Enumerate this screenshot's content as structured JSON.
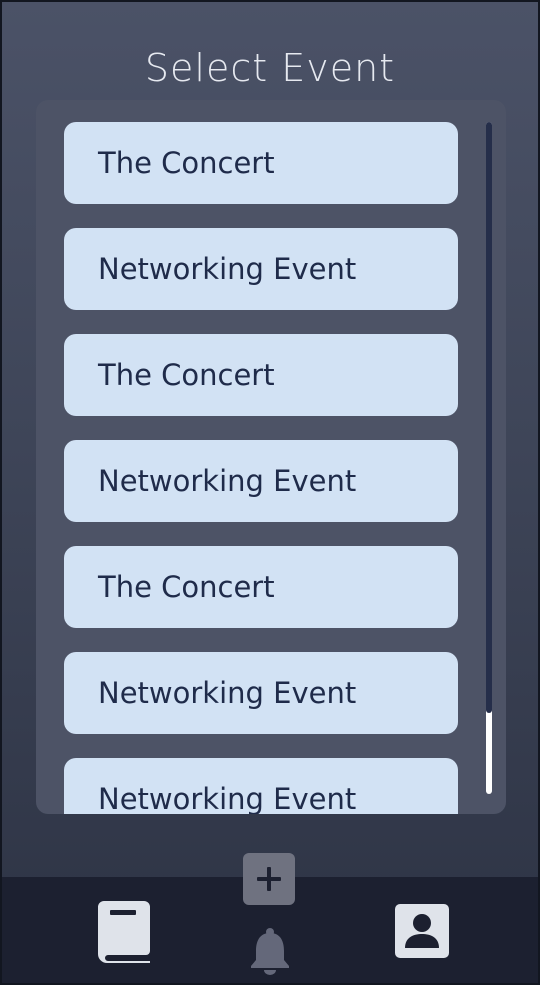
{
  "header": {
    "title": "Select Event"
  },
  "events": [
    {
      "label": "The Concert"
    },
    {
      "label": "Networking Event"
    },
    {
      "label": "The Concert"
    },
    {
      "label": "Networking Event"
    },
    {
      "label": "The Concert"
    },
    {
      "label": "Networking Event"
    },
    {
      "label": "Networking Event"
    }
  ],
  "scroll": {
    "visible_fraction": 0.88
  },
  "nav": {
    "items": [
      {
        "icon": "book-icon"
      },
      {
        "icon": "bell-icon"
      },
      {
        "icon": "account-box-icon"
      }
    ],
    "add_icon": "plus-icon"
  },
  "colors": {
    "background_top": "#4b5267",
    "panel": "#4d5366",
    "item": "#d2e2f4",
    "item_text": "#1f2b4a",
    "nav_bar": "#1c2030",
    "icon": "#dfe3ea",
    "scroll_thumb": "#252e4a"
  }
}
